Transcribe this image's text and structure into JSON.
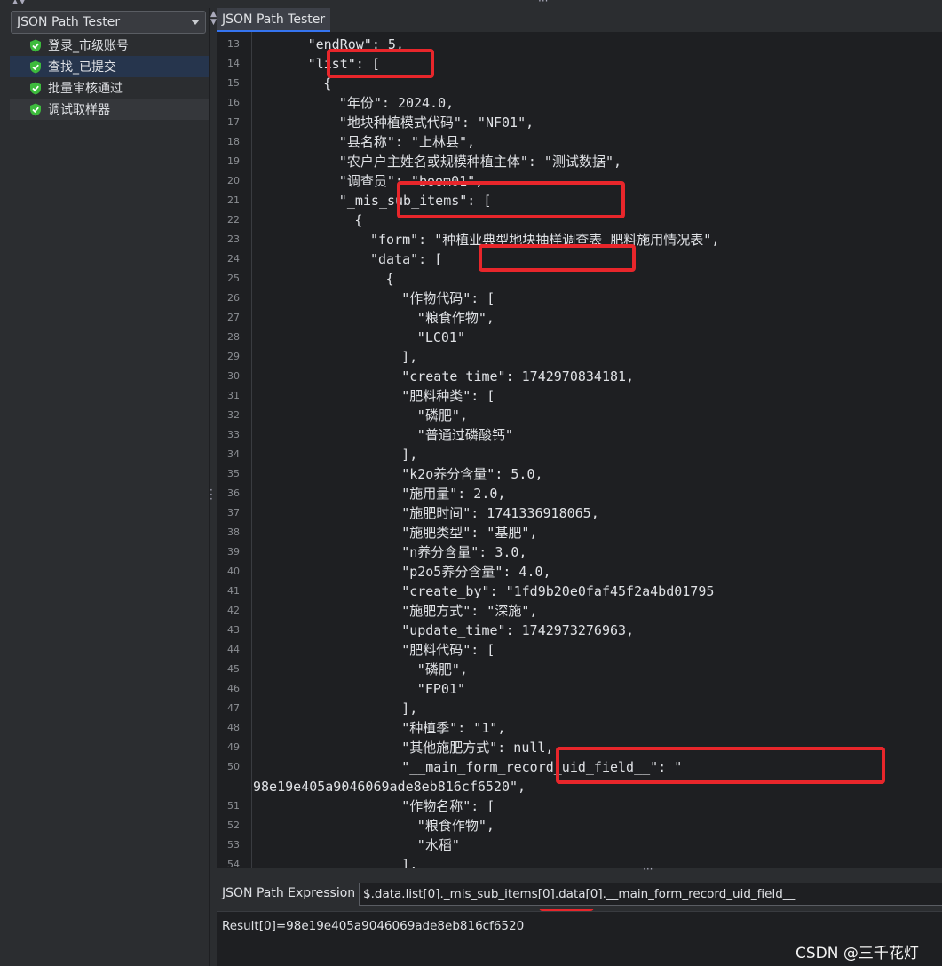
{
  "sampler_selector": {
    "value": "JSON Path Tester"
  },
  "tree": [
    {
      "label": "登录_市级账号",
      "state": "normal"
    },
    {
      "label": "查找_已提交",
      "state": "selected"
    },
    {
      "label": "批量审核通过",
      "state": "normal"
    },
    {
      "label": "调试取样器",
      "state": "soft"
    }
  ],
  "tab": {
    "label": "JSON Path Tester"
  },
  "code_lines": [
    {
      "n": "13",
      "indent": 7,
      "text": "\"endRow\": 5,"
    },
    {
      "n": "14",
      "indent": 7,
      "text": "\"list\": ["
    },
    {
      "n": "15",
      "indent": 9,
      "text": "{"
    },
    {
      "n": "16",
      "indent": 11,
      "text": "\"年份\": 2024.0,"
    },
    {
      "n": "17",
      "indent": 11,
      "text": "\"地块种植模式代码\": \"NF01\","
    },
    {
      "n": "18",
      "indent": 11,
      "text": "\"县名称\": \"上林县\","
    },
    {
      "n": "19",
      "indent": 11,
      "text": "\"农户户主姓名或规模种植主体\": \"测试数据\","
    },
    {
      "n": "20",
      "indent": 11,
      "text": "\"调查员\": \"boom01\","
    },
    {
      "n": "21",
      "indent": 11,
      "text": "\"_mis_sub_items\": ["
    },
    {
      "n": "22",
      "indent": 13,
      "text": "{"
    },
    {
      "n": "23",
      "indent": 15,
      "text": "\"form\": \"种植业典型地块抽样调查表_肥料施用情况表\","
    },
    {
      "n": "24",
      "indent": 15,
      "text": "\"data\": ["
    },
    {
      "n": "25",
      "indent": 17,
      "text": "{"
    },
    {
      "n": "26",
      "indent": 19,
      "text": "\"作物代码\": ["
    },
    {
      "n": "27",
      "indent": 21,
      "text": "\"粮食作物\","
    },
    {
      "n": "28",
      "indent": 21,
      "text": "\"LC01\""
    },
    {
      "n": "29",
      "indent": 19,
      "text": "],"
    },
    {
      "n": "30",
      "indent": 19,
      "text": "\"create_time\": 1742970834181,"
    },
    {
      "n": "31",
      "indent": 19,
      "text": "\"肥料种类\": ["
    },
    {
      "n": "32",
      "indent": 21,
      "text": "\"磷肥\","
    },
    {
      "n": "33",
      "indent": 21,
      "text": "\"普通过磷酸钙\""
    },
    {
      "n": "34",
      "indent": 19,
      "text": "],"
    },
    {
      "n": "35",
      "indent": 19,
      "text": "\"k2o养分含量\": 5.0,"
    },
    {
      "n": "36",
      "indent": 19,
      "text": "\"施用量\": 2.0,"
    },
    {
      "n": "37",
      "indent": 19,
      "text": "\"施肥时间\": 1741336918065,"
    },
    {
      "n": "38",
      "indent": 19,
      "text": "\"施肥类型\": \"基肥\","
    },
    {
      "n": "39",
      "indent": 19,
      "text": "\"n养分含量\": 3.0,"
    },
    {
      "n": "40",
      "indent": 19,
      "text": "\"p2o5养分含量\": 4.0,"
    },
    {
      "n": "41",
      "indent": 19,
      "text": "\"create_by\": \"1fd9b20e0faf45f2a4bd01795"
    },
    {
      "n": "42",
      "indent": 19,
      "text": "\"施肥方式\": \"深施\","
    },
    {
      "n": "43",
      "indent": 19,
      "text": "\"update_time\": 1742973276963,"
    },
    {
      "n": "44",
      "indent": 19,
      "text": "\"肥料代码\": ["
    },
    {
      "n": "45",
      "indent": 21,
      "text": "\"磷肥\","
    },
    {
      "n": "46",
      "indent": 21,
      "text": "\"FP01\""
    },
    {
      "n": "47",
      "indent": 19,
      "text": "],"
    },
    {
      "n": "48",
      "indent": 19,
      "text": "\"种植季\": \"1\","
    },
    {
      "n": "49",
      "indent": 19,
      "text": "\"其他施肥方式\": null,"
    },
    {
      "n": "50",
      "indent": 19,
      "text": "\"__main_form_record_uid_field__\": \""
    },
    {
      "n": "",
      "indent": 0,
      "text": "98e19e405a9046069ade8eb816cf6520\","
    },
    {
      "n": "51",
      "indent": 19,
      "text": "\"作物名称\": ["
    },
    {
      "n": "52",
      "indent": 21,
      "text": "\"粮食作物\","
    },
    {
      "n": "53",
      "indent": 21,
      "text": "\"水稻\""
    },
    {
      "n": "54",
      "indent": 19,
      "text": "],"
    }
  ],
  "expression": {
    "label": "JSON Path Expression",
    "value": "$.data.list[0]._mis_sub_items[0].data[0].__main_form_record_uid_field__"
  },
  "result": {
    "value": "Result[0]=98e19e405a9046069ade8eb816cf6520"
  },
  "watermark": "CSDN @三千花灯",
  "colors": {
    "highlight": "#e8262b",
    "selection": "#26354d",
    "check": "#3dbb3d"
  }
}
